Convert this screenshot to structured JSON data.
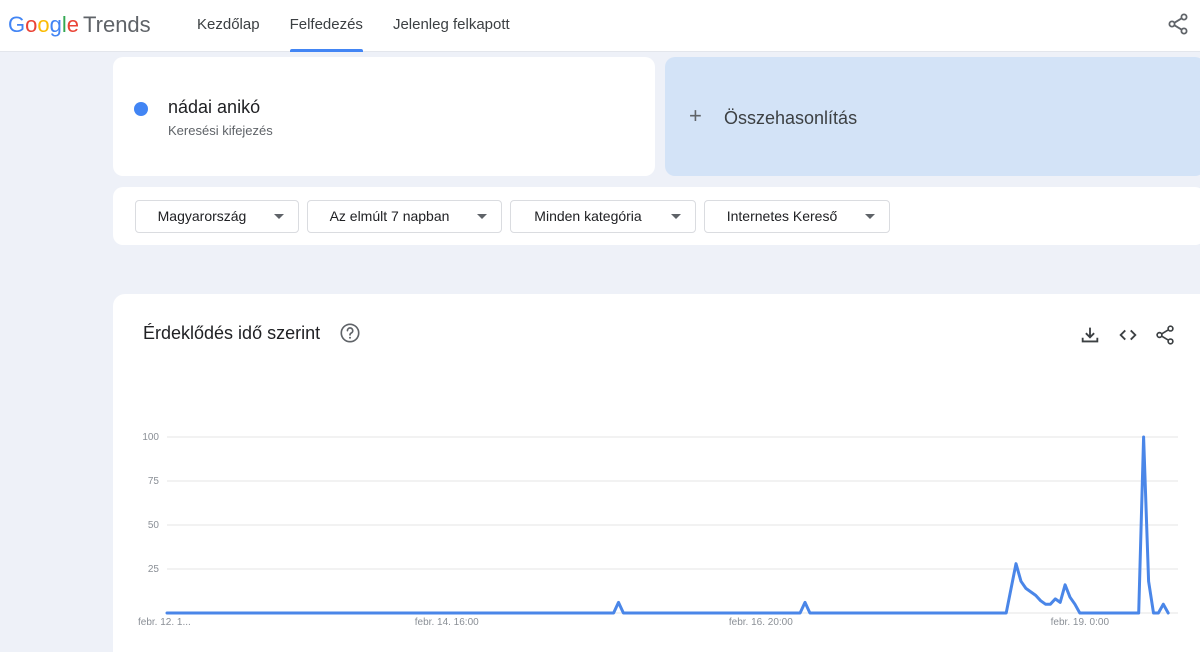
{
  "header": {
    "logo_google_letters": [
      "G",
      "o",
      "o",
      "g",
      "l",
      "e"
    ],
    "logo_google_colors": [
      "#4285f4",
      "#ea4335",
      "#fbbc05",
      "#4285f4",
      "#34a853",
      "#ea4335"
    ],
    "logo_trends": "Trends",
    "nav": [
      {
        "label": "Kezdőlap",
        "active": false
      },
      {
        "label": "Felfedezés",
        "active": true
      },
      {
        "label": "Jelenleg felkapott",
        "active": false
      }
    ],
    "share_icon": "share-icon"
  },
  "term": {
    "name": "nádai anikó",
    "type": "Keresési kifejezés",
    "color": "#4285f4"
  },
  "compare": {
    "plus": "+",
    "label": "Összehasonlítás"
  },
  "filters": [
    {
      "label": "Magyarország"
    },
    {
      "label": "Az elmúlt 7 napban"
    },
    {
      "label": "Minden kategória"
    },
    {
      "label": "Internetes Kereső"
    }
  ],
  "interest": {
    "title": "Érdeklődés idő szerint",
    "icons": [
      "help-icon",
      "download-icon",
      "embed-icon",
      "share-icon"
    ]
  },
  "chart_data": {
    "type": "line",
    "title": "Érdeklődés idő szerint",
    "y_ticks": [
      "100",
      "75",
      "50",
      "25"
    ],
    "ylim": [
      0,
      100
    ],
    "x_tick_labels": [
      "febr. 12. 1...",
      "febr. 14. 16:00",
      "febr. 16. 20:00",
      "febr. 19. 0:00"
    ],
    "x_tick_positions": [
      0,
      57,
      121,
      186
    ],
    "x_range": [
      0,
      206
    ],
    "series": [
      {
        "color": "#4a86e8",
        "points": [
          [
            0,
            0
          ],
          [
            91,
            0
          ],
          [
            92,
            6
          ],
          [
            93,
            0
          ],
          [
            129,
            0
          ],
          [
            130,
            6
          ],
          [
            131,
            0
          ],
          [
            171,
            0
          ],
          [
            173,
            28
          ],
          [
            174,
            18
          ],
          [
            175,
            14
          ],
          [
            176,
            12
          ],
          [
            177,
            10
          ],
          [
            178,
            7
          ],
          [
            179,
            5
          ],
          [
            180,
            5
          ],
          [
            181,
            8
          ],
          [
            182,
            6
          ],
          [
            183,
            16
          ],
          [
            184,
            9
          ],
          [
            185,
            5
          ],
          [
            186,
            0
          ],
          [
            198,
            0
          ],
          [
            199,
            100
          ],
          [
            200,
            18
          ],
          [
            201,
            0
          ],
          [
            202,
            0
          ],
          [
            203,
            5
          ],
          [
            204,
            0
          ]
        ]
      }
    ]
  }
}
